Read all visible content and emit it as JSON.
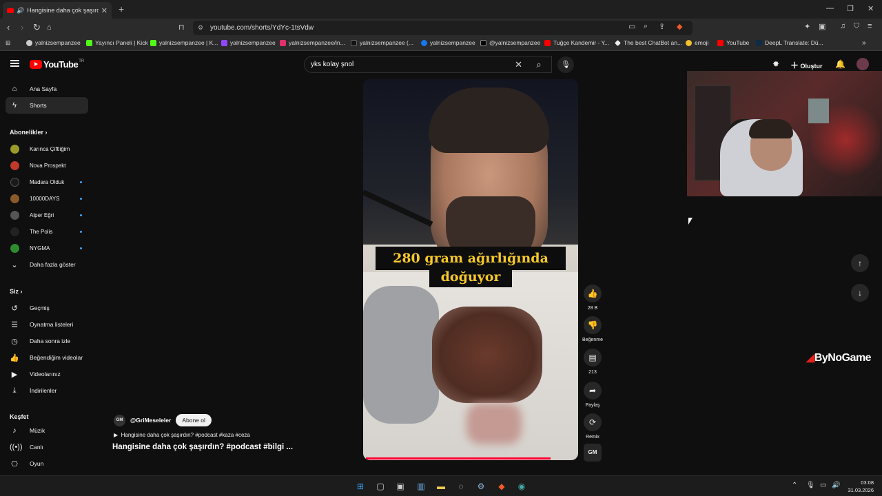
{
  "browser": {
    "tab_title": "Hangisine daha çok şaşırdın? #...",
    "url": "youtube.com/shorts/YdYc-1tsVdw",
    "bookmarks": [
      "yalnizsempanzee",
      "Yayıncı Paneli | Kick",
      "yalnizsempanzee | K...",
      "yalnizsempanzee",
      "yalnizsempanzee/in...",
      "yalnizsempanzee (...",
      "yalnizsempanzee",
      "@yalnizsempanzee",
      "Tuğçe Kandemir - Y...",
      "The best ChatBot an...",
      "emoji",
      "YouTube",
      "DeepL Translate: Dü..."
    ]
  },
  "youtube": {
    "logo": "YouTube",
    "region": "TR",
    "search_value": "yks kolay şnol",
    "create_label": "Oluştur"
  },
  "sidebar": {
    "home": "Ana Sayfa",
    "shorts": "Shorts",
    "subs_heading": "Abonelikler",
    "channels": [
      {
        "name": "Karınca Çiftliğim",
        "color": "#9a9a2a",
        "new": false
      },
      {
        "name": "Nova Prospekt",
        "color": "#c0392b",
        "new": false
      },
      {
        "name": "Madara Olduk",
        "color": "#1a1a1a",
        "new": true
      },
      {
        "name": "10000DAYS",
        "color": "#8a5a2a",
        "new": true
      },
      {
        "name": "Alper Eğri",
        "color": "#555555",
        "new": true
      },
      {
        "name": "The Polis",
        "color": "#222222",
        "new": true
      },
      {
        "name": "NYGMA",
        "color": "#2e8b2e",
        "new": true
      }
    ],
    "show_more": "Daha fazla göster",
    "you_heading": "Siz",
    "you_items": [
      "Geçmiş",
      "Oynatma listeleri",
      "Daha sonra izle",
      "Beğendiğim videolar",
      "Videolarınız",
      "İndirilenler"
    ],
    "explore_heading": "Keşfet",
    "explore_items": [
      "Müzik",
      "Canlı",
      "Oyun"
    ]
  },
  "short": {
    "caption_line1": "280 gram ağırlığında",
    "caption_line2": "doğuyor",
    "channel_handle": "@GriMeseleler",
    "channel_avatar": "GM",
    "subscribe": "Abone ol",
    "sound": "Hangisine daha çok şaşırdın? #podcast #kaza #ceza",
    "title": "Hangisine daha çok şaşırdın? #podcast #bilgi ...",
    "progress": 0.88,
    "likes": "28 B",
    "dislike_label": "Beğenme",
    "comments": "213",
    "share_label": "Paylaş",
    "remix_label": "Remix"
  },
  "overlay": {
    "brand_mark": "",
    "brand_text": "ByNoGame"
  },
  "taskbar": {
    "time": "03:08",
    "date": "31.03.2026"
  }
}
